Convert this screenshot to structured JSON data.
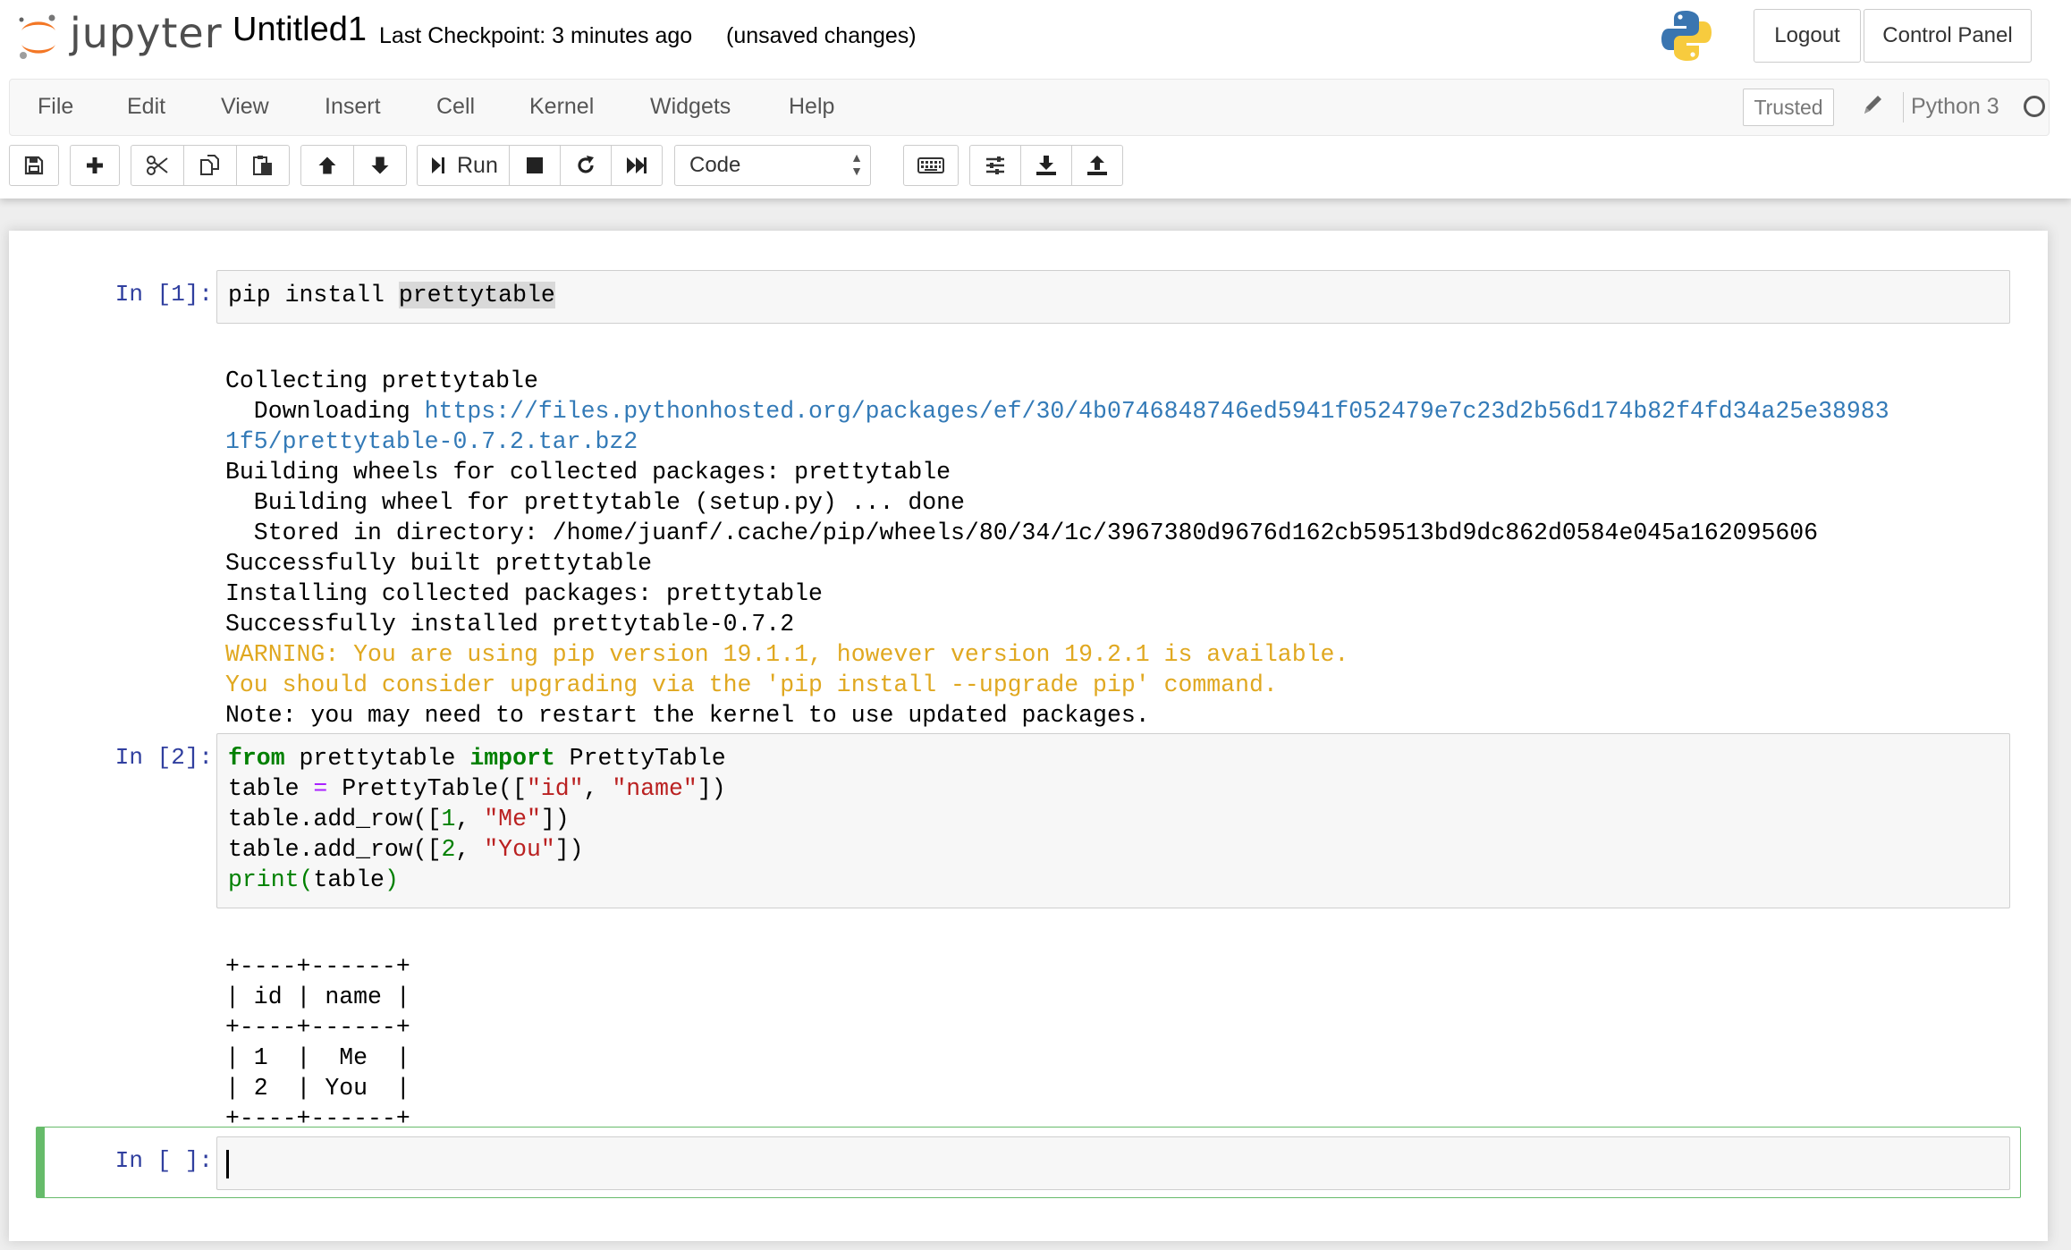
{
  "header": {
    "logo_text": "jupyter",
    "notebook_name": "Untitled1",
    "checkpoint": "Last Checkpoint: 3 minutes ago",
    "autosave_status": "(unsaved changes)",
    "logout_label": "Logout",
    "control_panel_label": "Control Panel"
  },
  "menubar": {
    "items": [
      "File",
      "Edit",
      "View",
      "Insert",
      "Cell",
      "Kernel",
      "Widgets",
      "Help"
    ],
    "trusted_label": "Trusted",
    "kernel_name": "Python 3"
  },
  "toolbar": {
    "run_label": "Run",
    "cell_type": "Code",
    "icons": [
      "save-icon",
      "plus-icon",
      "cut-icon",
      "copy-icon",
      "paste-icon",
      "arrow-up-icon",
      "arrow-down-icon",
      "run-icon",
      "stop-icon",
      "restart-icon",
      "fast-forward-icon",
      "keyboard-icon",
      "sliders-icon",
      "download-icon",
      "upload-icon"
    ]
  },
  "cells": [
    {
      "prompt": "In [1]:",
      "source_plain": "pip install ",
      "source_highlighted": "prettytable",
      "output": {
        "l1": "Collecting prettytable",
        "l2_prefix": "  Downloading ",
        "l2_link": "https://files.pythonhosted.org/packages/ef/30/4b0746848746ed5941f052479e7c23d2b56d174b82f4fd34a25e38983",
        "l3_link": "1f5/prettytable-0.7.2.tar.bz2",
        "l4": "Building wheels for collected packages: prettytable",
        "l5": "  Building wheel for prettytable (setup.py) ... done",
        "l6": "  Stored in directory: /home/juanf/.cache/pip/wheels/80/34/1c/3967380d9676d162cb59513bd9dc862d0584e045a162095606",
        "l7": "Successfully built prettytable",
        "l8": "Installing collected packages: prettytable",
        "l9": "Successfully installed prettytable-0.7.2",
        "l10": "WARNING: You are using pip version 19.1.1, however version 19.2.1 is available.",
        "l11": "You should consider upgrading via the 'pip install --upgrade pip' command.",
        "l12": "Note: you may need to restart the kernel to use updated packages."
      }
    },
    {
      "prompt": "In [2]:",
      "code": {
        "kw_from": "from",
        "mod": " prettytable ",
        "kw_import": "import",
        "cls": " PrettyTable",
        "l2a": "table ",
        "l2op": "=",
        "l2b": " PrettyTable([",
        "s_id": "\"id\"",
        "comma": ", ",
        "s_name": "\"name\"",
        "l2end": "])",
        "l3a": "table.add_row([",
        "n1": "1",
        "s_me": "\"Me\"",
        "l3end": "])",
        "l4a": "table.add_row([",
        "n2": "2",
        "s_you": "\"You\"",
        "l4end": "])",
        "print_kw": "print",
        "paren_open": "(",
        "print_arg": "table",
        "paren_close": ")"
      },
      "output": {
        "t1": "+----+------+",
        "t2": "| id | name |",
        "t3": "+----+------+",
        "t4": "| 1  |  Me  |",
        "t5": "| 2  | You  |",
        "t6": "+----+------+"
      }
    },
    {
      "prompt": "In [ ]:"
    }
  ],
  "colors": {
    "prompt": "#303f9f",
    "keyword": "#008000",
    "string": "#ba2121",
    "link": "#337ab7",
    "warning": "#e0a820",
    "active_cell": "#66bb6a"
  }
}
